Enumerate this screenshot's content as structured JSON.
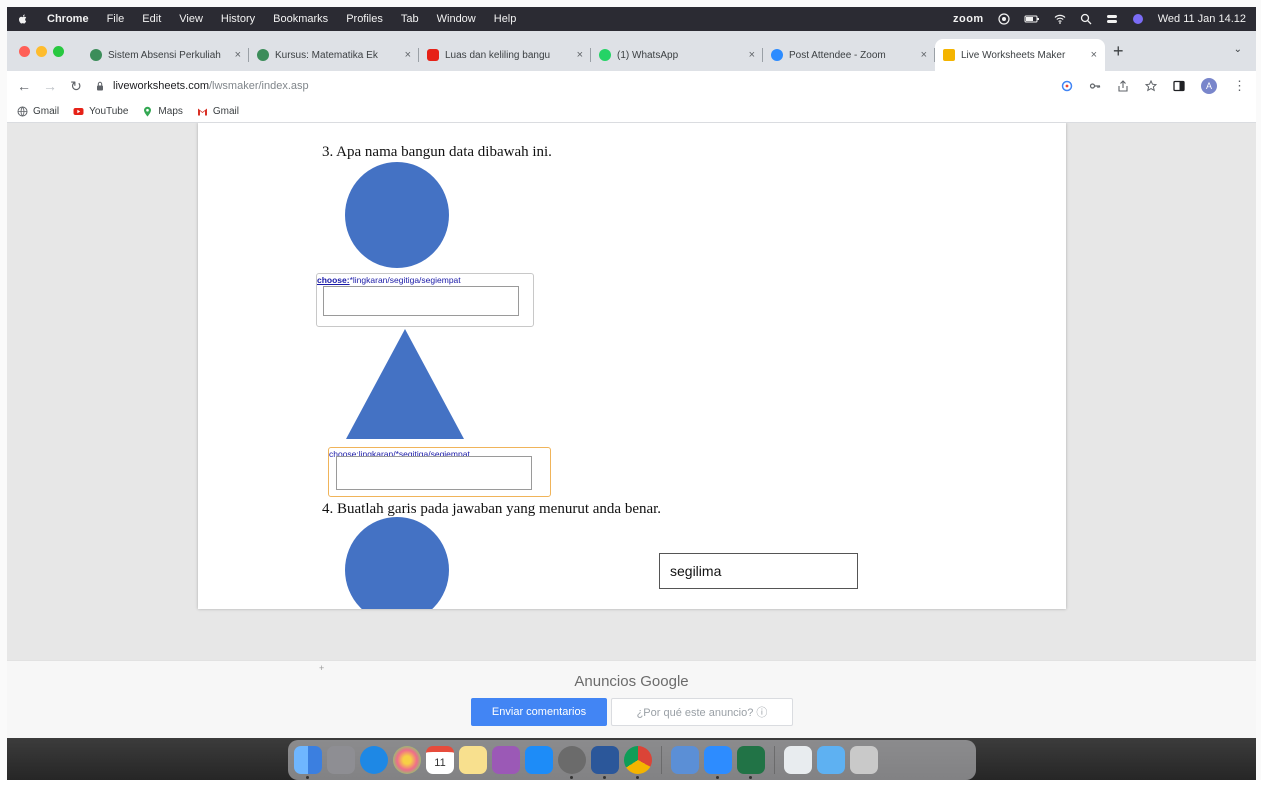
{
  "menubar": {
    "app": "Chrome",
    "items": [
      "File",
      "Edit",
      "View",
      "History",
      "Bookmarks",
      "Profiles",
      "Tab",
      "Window",
      "Help"
    ],
    "zoom_label": "zoom",
    "datetime": "Wed 11 Jan  14.12"
  },
  "tabs": [
    {
      "label": "Sistem Absensi Perkuliah",
      "close": "×",
      "color": "#3c8d5a"
    },
    {
      "label": "Kursus: Matematika Ek",
      "close": "×",
      "color": "#3c8d5a"
    },
    {
      "label": "Luas dan keliling bangu",
      "close": "×",
      "color": "#e62117"
    },
    {
      "label": "(1) WhatsApp",
      "close": "×",
      "color": "#25d366"
    },
    {
      "label": "Post Attendee - Zoom",
      "close": "×",
      "color": "#2d8cff"
    },
    {
      "label": "Live Worksheets Maker",
      "close": "×",
      "color": "#f4b400",
      "active": true
    }
  ],
  "new_tab": "+",
  "tab_menu": "⌄",
  "address": {
    "host": "liveworksheets.com",
    "path": "/lwsmaker/index.asp"
  },
  "profile_initial": "A",
  "bookmarks": [
    {
      "label": "Gmail",
      "icon": "globe-icon",
      "color": "#5f6368"
    },
    {
      "label": "YouTube",
      "icon": "youtube-icon",
      "color": "#e62117"
    },
    {
      "label": "Maps",
      "icon": "maps-pin-icon",
      "color": "#34a853"
    },
    {
      "label": "Gmail",
      "icon": "gmail-icon",
      "color": "#d93025"
    }
  ],
  "worksheet": {
    "q3": "3.   Apa nama bangun data dibawah ini.",
    "choose1_prefix": "choose:",
    "choose1_rest": "*lingkaran/segitiga/segiempat",
    "choose2": "choose:lingkaran/*segitiga/segiempat",
    "q4": "4.   Buatlah garis pada jawaban yang menurut anda benar.",
    "answer_text": "segilima",
    "shape_color": "#4472c4"
  },
  "ads": {
    "marker": "+",
    "title_prefix": "Anuncios ",
    "title_brand": "Google",
    "feedback_button": "Enviar comentarios",
    "why_button": "¿Por qué este anuncio? ⓘ"
  },
  "dock": {
    "calendar_day": "11",
    "apps": [
      {
        "name": "finder",
        "color": "#3b8ee8"
      },
      {
        "name": "launchpad",
        "color": "#8e8e93"
      },
      {
        "name": "safari",
        "color": "#1e88e5"
      },
      {
        "name": "photos",
        "color": "#f39c12"
      },
      {
        "name": "calendar",
        "color": "#ffffff"
      },
      {
        "name": "notes",
        "color": "#f8e08e"
      },
      {
        "name": "podcasts",
        "color": "#9b59b6"
      },
      {
        "name": "app-store",
        "color": "#1d8cf8"
      },
      {
        "name": "system-preferences",
        "color": "#6b6b6b"
      },
      {
        "name": "word",
        "color": "#2b579a"
      },
      {
        "name": "chrome",
        "color": "#db4437"
      },
      {
        "name": "preview",
        "color": "#5b8fd6"
      },
      {
        "name": "zoom",
        "color": "#2d8cff"
      },
      {
        "name": "excel",
        "color": "#217346"
      },
      {
        "name": "downloads",
        "color": "#e8ecef"
      },
      {
        "name": "folder",
        "color": "#5eb1f2"
      },
      {
        "name": "trash",
        "color": "#c9c9c9"
      }
    ]
  }
}
